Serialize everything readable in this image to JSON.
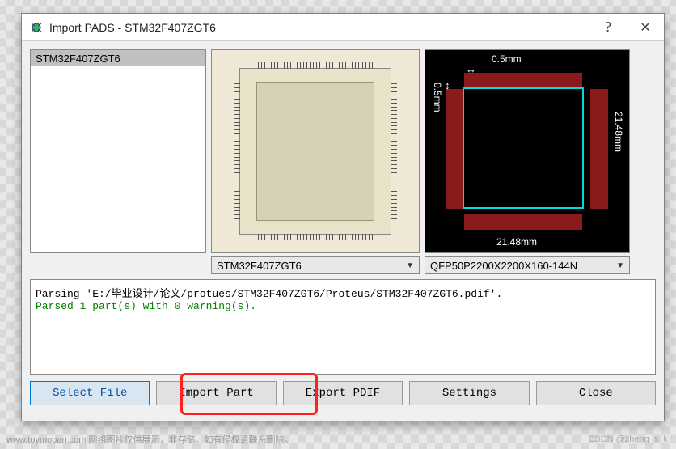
{
  "window": {
    "title": "Import PADS - STM32F407ZGT6",
    "help_label": "?",
    "close_label": "✕"
  },
  "parts_list": {
    "items": [
      "STM32F407ZGT6"
    ]
  },
  "schematic_combo": "STM32F407ZGT6",
  "footprint_combo": "QFP50P2200X2200X160-144N",
  "footprint": {
    "top_dim": "0.5mm",
    "left_dim": "0.5mm",
    "right_dim": "21.48mm",
    "bottom_dim": "21.48mm"
  },
  "log": {
    "line1": "Parsing 'E:/毕业设计/论文/protues/STM32F407ZGT6/Proteus/STM32F407ZGT6.pdif'.",
    "line2": "Parsed 1 part(s) with 0 warning(s)."
  },
  "buttons": {
    "select_file": "Select File",
    "import_part": "Import Part",
    "export_pdif": "Export PDIF",
    "settings": "Settings",
    "close": "Close"
  },
  "watermark": "www.toymoban.com  网络图片仅供展示，非存储。如有侵权请联系删除。",
  "credit": "CSDN @zheng_s_k"
}
